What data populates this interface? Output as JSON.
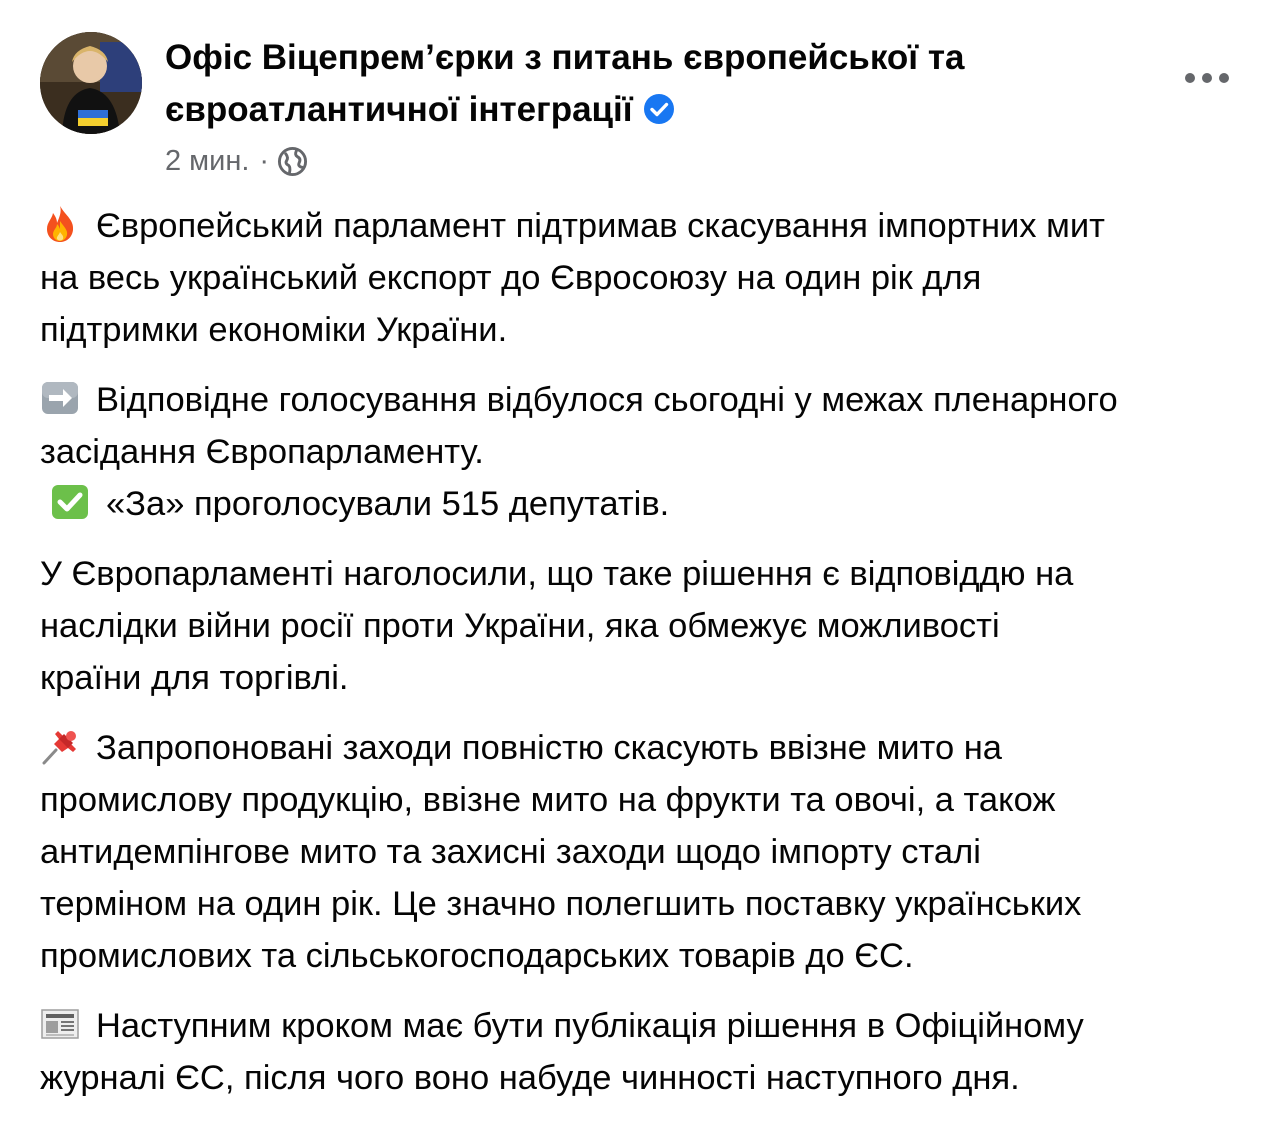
{
  "post": {
    "author_name_line1": "Офіс Віцепрем’єрки з питань європейської та",
    "author_name_line2": "євроатлантичної інтеграції",
    "verified_icon": "verified-badge",
    "timestamp": "2 мин.",
    "separator": "·",
    "audience_icon": "globe-icon",
    "more_icon": "more-horizontal-icon"
  },
  "paragraphs": [
    {
      "emoji": "fire-emoji",
      "lines": [
        "Європейський парламент підтримав скасування імпортних мит",
        "на весь український експорт до Євросоюзу на один рік для",
        "підтримки економіки України."
      ]
    },
    {
      "emoji": "right-arrow-emoji",
      "lines": [
        "Відповідне голосування відбулося сьогодні у межах пленарного",
        "засідання Європарламенту."
      ],
      "check_emoji": "check-mark-button-emoji",
      "check_line": "«За» проголосували 515 депутатів."
    },
    {
      "lines": [
        "У Європарламенті наголосили, що таке рішення є відповіддю на",
        "наслідки війни росії проти України, яка обмежує можливості",
        "країни для торгівлі."
      ]
    },
    {
      "emoji": "pushpin-emoji",
      "lines": [
        "Запропоновані заходи повністю скасують ввізне мито на",
        "промислову продукцію, ввізне мито на фрукти та овочі, а також",
        "антидемпінгове мито та захисні заходи щодо імпорту сталі",
        "терміном на один рік. Це значно полегшить поставку українських",
        "промислових та сільськогосподарських товарів до ЄС."
      ]
    },
    {
      "emoji": "newspaper-emoji",
      "lines": [
        "Наступним кроком має бути публікація рішення в Офіційному",
        "журналі ЄС, після чого воно набуде чинності наступного дня."
      ]
    }
  ],
  "colors": {
    "text": "#050505",
    "secondary_text": "#65676b",
    "verified_blue": "#1877f2"
  }
}
